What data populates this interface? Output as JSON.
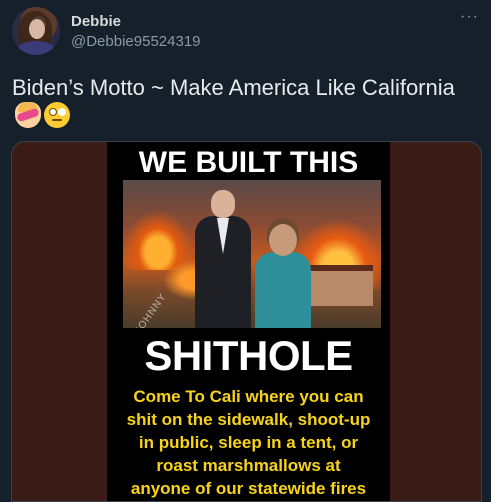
{
  "tweet": {
    "author_name": "Debbie",
    "author_handle": "@Debbie95524319",
    "more_label": "···",
    "text": "Biden’s Motto ~ Make America Like California",
    "emojis": [
      "face-palm-emoji",
      "eye-roll-emoji"
    ]
  },
  "media": {
    "headline": "WE BUILT THIS",
    "big_word": "SHITHOLE",
    "watermark": "JOHNNY",
    "caption_lines": [
      "Come To Cali where you can",
      "shit on the sidewalk, shoot-up",
      "in public, sleep in a tent, or",
      "roast marshmallows at",
      "anyone of our statewide fires"
    ]
  },
  "colors": {
    "background": "#15202b",
    "caption": "#f7d31a",
    "muted": "#8b98a5"
  }
}
